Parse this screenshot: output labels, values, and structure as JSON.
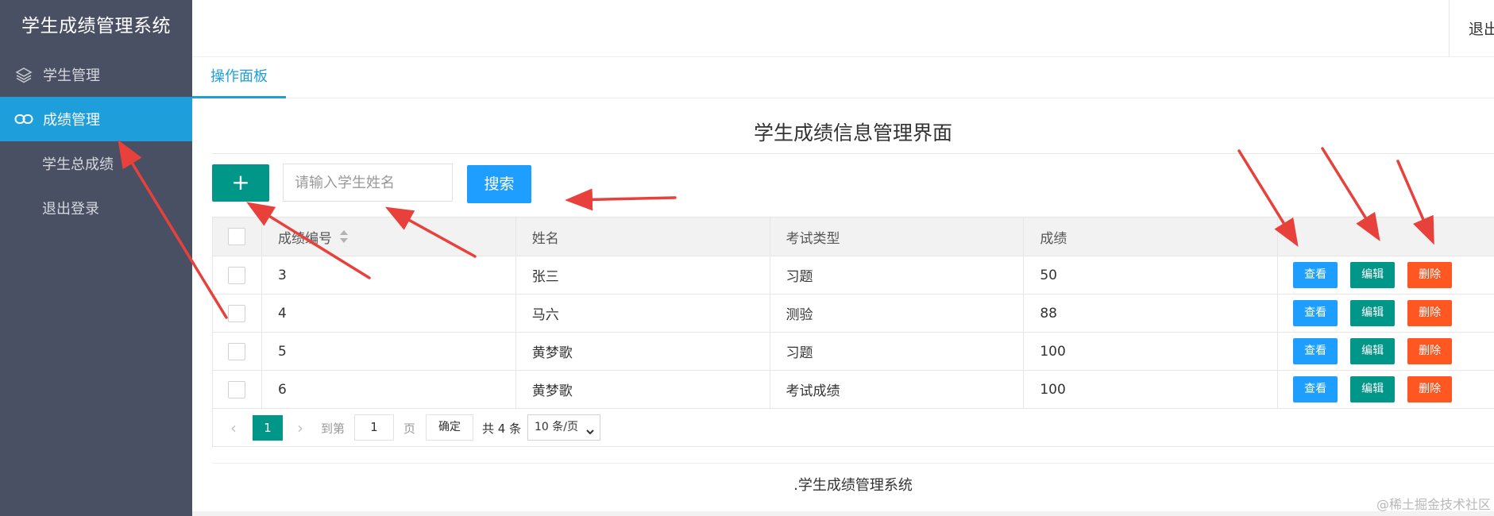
{
  "sidebar": {
    "logo": "学生成绩管理系统",
    "items": [
      {
        "label": "学生管理",
        "icon": "layers-icon"
      },
      {
        "label": "成绩管理",
        "icon": "link-icon",
        "active": true
      },
      {
        "label": "学生总成绩"
      },
      {
        "label": "退出登录"
      }
    ]
  },
  "header": {
    "logout": "退出"
  },
  "tabs": [
    {
      "label": "操作面板",
      "active": true
    }
  ],
  "main": {
    "title": "学生成绩信息管理界面",
    "add_label": "+",
    "search": {
      "placeholder": "请输入学生姓名",
      "value": ""
    },
    "search_label": "搜索"
  },
  "table": {
    "columns": [
      "成绩编号",
      "姓名",
      "考试类型",
      "成绩"
    ],
    "rows": [
      {
        "id": "3",
        "name": "张三",
        "type": "习题",
        "score": "50"
      },
      {
        "id": "4",
        "name": "马六",
        "type": "测验",
        "score": "88"
      },
      {
        "id": "5",
        "name": "黄梦歌",
        "type": "习题",
        "score": "100"
      },
      {
        "id": "6",
        "name": "黄梦歌",
        "type": "考试成绩",
        "score": "100"
      }
    ],
    "actions": {
      "view": "查看",
      "edit": "编辑",
      "delete": "删除"
    }
  },
  "pager": {
    "prev": "‹",
    "current": "1",
    "next": "›",
    "goto": "到第",
    "input": "1",
    "page": "页",
    "confirm": "确定",
    "total": "共 4 条",
    "page_size": "10 条/页"
  },
  "footer": ".学生成绩管理系统",
  "watermark": "@稀土掘金技术社区",
  "colors": {
    "sidebar": "#4a5064",
    "active": "#1e9fdc",
    "primary": "#009688",
    "info": "#1e9fff",
    "danger": "#ff5722",
    "annotation": "#e8413c"
  }
}
